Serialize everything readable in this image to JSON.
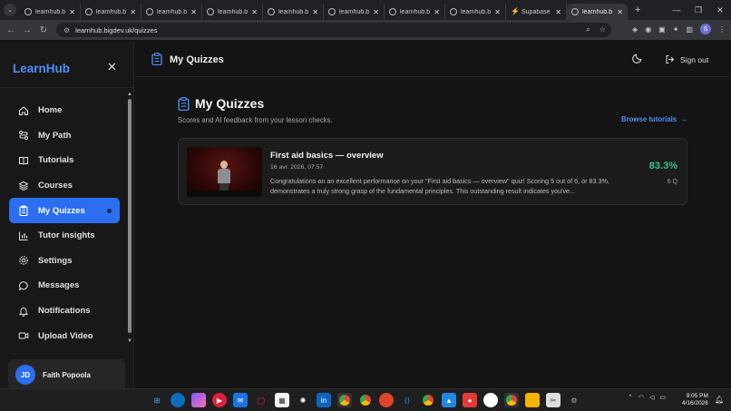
{
  "browser": {
    "tabs": [
      {
        "title": "learnhub.b",
        "favicon": "globe-icon"
      },
      {
        "title": "learnhub.b",
        "favicon": "globe-icon"
      },
      {
        "title": "learnhub.b",
        "favicon": "globe-icon"
      },
      {
        "title": "learnhub.b",
        "favicon": "globe-icon"
      },
      {
        "title": "learnhub.b",
        "favicon": "globe-icon"
      },
      {
        "title": "learnhub.b",
        "favicon": "globe-icon"
      },
      {
        "title": "learnhub.b",
        "favicon": "globe-icon"
      },
      {
        "title": "learnhub.b",
        "favicon": "globe-icon"
      },
      {
        "title": "Supabase",
        "favicon": "supabase-icon"
      },
      {
        "title": "learnhub.b",
        "favicon": "globe-icon",
        "active": true
      }
    ],
    "url": "learnhub.bigdev.uk/quizzes",
    "profile_initial": "S"
  },
  "sidebar": {
    "brand": "LearnHub",
    "items": [
      {
        "label": "Home",
        "icon": "home-icon"
      },
      {
        "label": "My Path",
        "icon": "route-icon"
      },
      {
        "label": "Tutorials",
        "icon": "book-icon"
      },
      {
        "label": "Courses",
        "icon": "layers-icon"
      },
      {
        "label": "My Quizzes",
        "icon": "clipboard-icon",
        "active": true
      },
      {
        "label": "Tutor insights",
        "icon": "bar-chart-icon"
      },
      {
        "label": "Settings",
        "icon": "gear-icon"
      },
      {
        "label": "Messages",
        "icon": "message-icon"
      },
      {
        "label": "Notifications",
        "icon": "bell-icon"
      },
      {
        "label": "Upload Video",
        "icon": "video-icon"
      }
    ],
    "user": {
      "initials": "JD",
      "name": "Faith Popoola"
    }
  },
  "topbar": {
    "title": "My Quizzes",
    "signout_label": "Sign out"
  },
  "main": {
    "heading": "My Quizzes",
    "subtitle": "Scores and AI feedback from your lesson checks.",
    "browse_label": "Browse tutorials",
    "quizzes": [
      {
        "title": "First aid basics — overview",
        "date": "16 avr. 2026, 07:57",
        "feedback": "Congratulations on an excellent performance on your \"First aid basics — overview\" quiz! Scoring 5 out of 6, or 83.3%, demonstrates a truly strong grasp of the fundamental principles. This outstanding result indicates you've...",
        "score": "83.3%",
        "questions": "6 Q"
      }
    ]
  },
  "taskbar": {
    "time": "9:05 PM",
    "date": "4/16/2026"
  },
  "colors": {
    "accent": "#2b6ef0",
    "brand": "#4f8ff7",
    "score": "#37c28a"
  }
}
